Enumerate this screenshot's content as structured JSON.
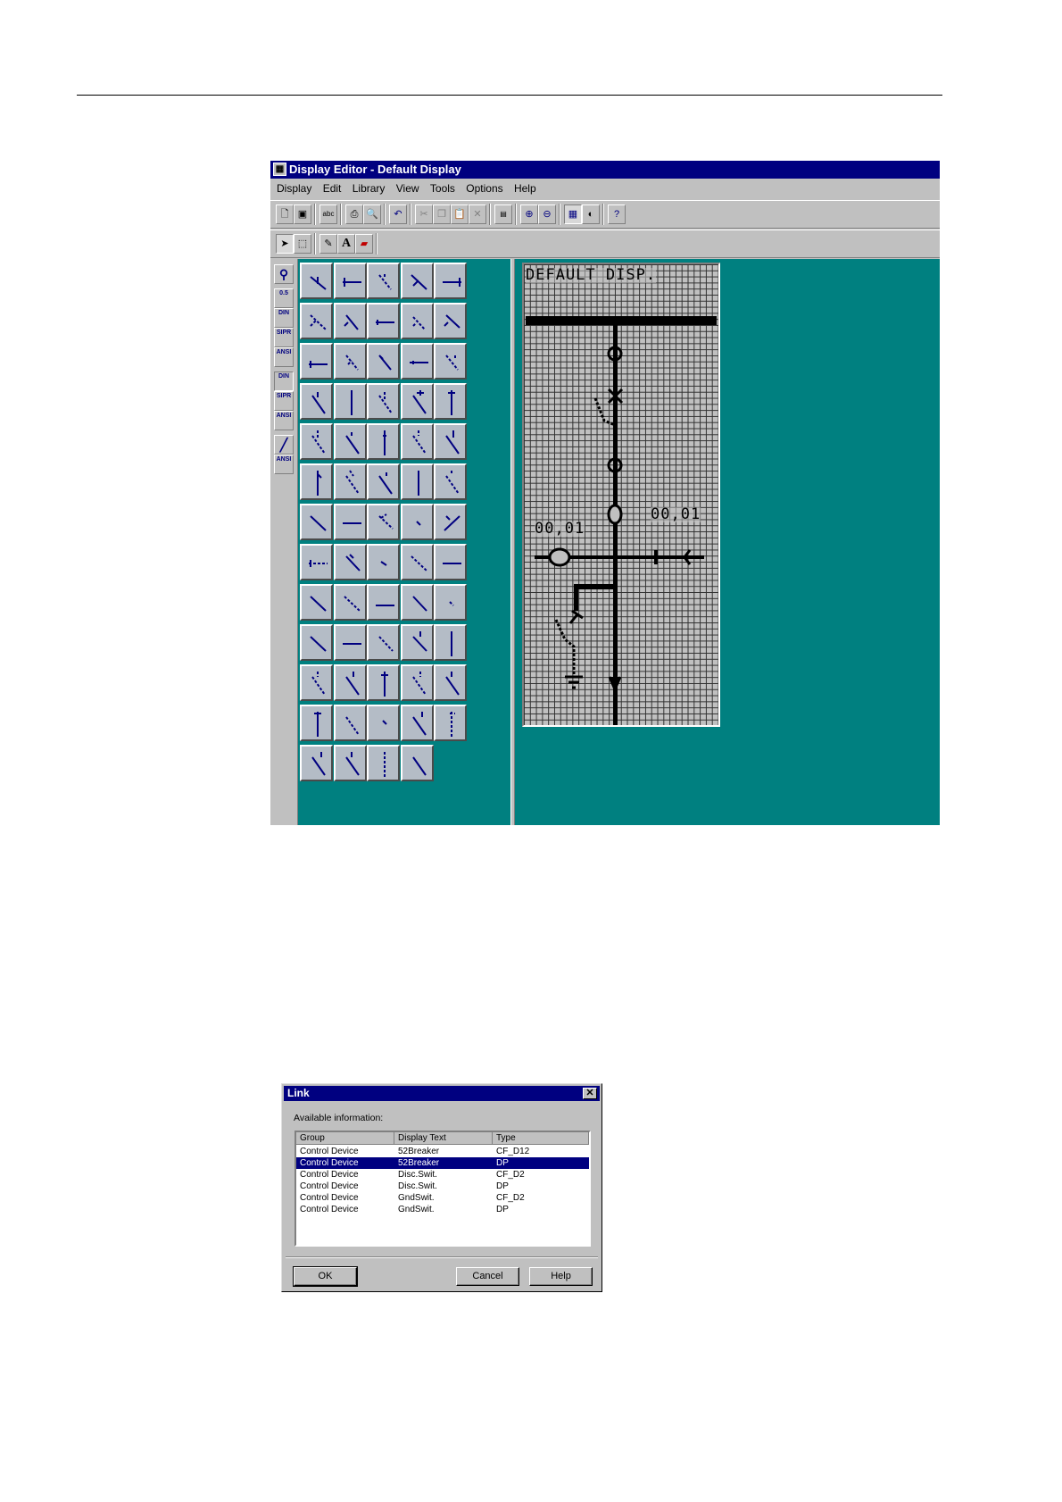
{
  "editor": {
    "title": "Display Editor - Default Display",
    "app_icon": "display-editor-icon",
    "menu": [
      "Display",
      "Edit",
      "Library",
      "View",
      "Tools",
      "Options",
      "Help"
    ],
    "toolbar_icons": [
      "new-icon",
      "save-icon",
      "spellcheck-icon",
      "print-icon",
      "print-preview-icon",
      "undo-icon",
      "cut-icon",
      "copy-icon",
      "paste-icon",
      "delete-icon",
      "properties-icon",
      "zoom-in-icon",
      "zoom-out-icon",
      "grid-icon",
      "contrast-icon",
      "help-icon"
    ],
    "draw_tools": [
      "pointer-icon",
      "select-rect-icon",
      "pencil-icon",
      "text-icon",
      "eraser-icon"
    ],
    "lcd": {
      "title": "DEFAULT DISP.",
      "value_left": "00,01",
      "value_right": "00,01"
    }
  },
  "link_dialog": {
    "title": "Link",
    "label": "Available information:",
    "columns": [
      "Group",
      "Display Text",
      "Type"
    ],
    "rows": [
      {
        "group": "Control Device",
        "text": "52Breaker",
        "type": "CF_D12"
      },
      {
        "group": "Control Device",
        "text": "52Breaker",
        "type": "DP"
      },
      {
        "group": "Control Device",
        "text": "Disc.Swit.",
        "type": "CF_D2"
      },
      {
        "group": "Control Device",
        "text": "Disc.Swit.",
        "type": "DP"
      },
      {
        "group": "Control Device",
        "text": "GndSwit.",
        "type": "CF_D2"
      },
      {
        "group": "Control Device",
        "text": "GndSwit.",
        "type": "DP"
      }
    ],
    "selected_row": 1,
    "ok_label": "OK",
    "cancel_label": "Cancel",
    "help_label": "Help"
  }
}
